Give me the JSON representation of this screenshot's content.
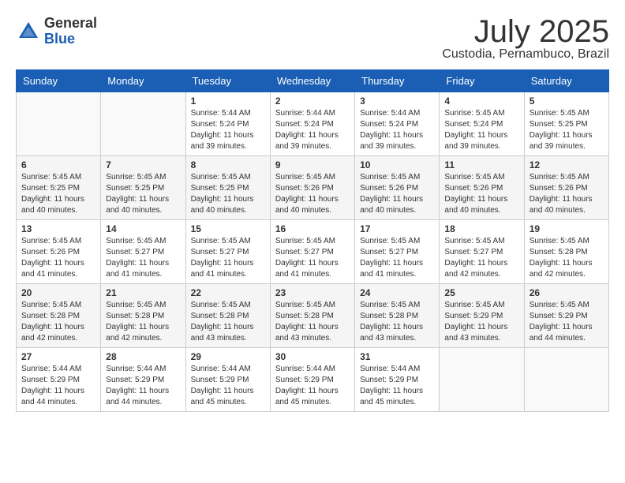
{
  "logo": {
    "general": "General",
    "blue": "Blue"
  },
  "title": "July 2025",
  "location": "Custodia, Pernambuco, Brazil",
  "days_of_week": [
    "Sunday",
    "Monday",
    "Tuesday",
    "Wednesday",
    "Thursday",
    "Friday",
    "Saturday"
  ],
  "weeks": [
    [
      {
        "day": "",
        "info": ""
      },
      {
        "day": "",
        "info": ""
      },
      {
        "day": "1",
        "info": "Sunrise: 5:44 AM\nSunset: 5:24 PM\nDaylight: 11 hours and 39 minutes."
      },
      {
        "day": "2",
        "info": "Sunrise: 5:44 AM\nSunset: 5:24 PM\nDaylight: 11 hours and 39 minutes."
      },
      {
        "day": "3",
        "info": "Sunrise: 5:44 AM\nSunset: 5:24 PM\nDaylight: 11 hours and 39 minutes."
      },
      {
        "day": "4",
        "info": "Sunrise: 5:45 AM\nSunset: 5:24 PM\nDaylight: 11 hours and 39 minutes."
      },
      {
        "day": "5",
        "info": "Sunrise: 5:45 AM\nSunset: 5:25 PM\nDaylight: 11 hours and 39 minutes."
      }
    ],
    [
      {
        "day": "6",
        "info": "Sunrise: 5:45 AM\nSunset: 5:25 PM\nDaylight: 11 hours and 40 minutes."
      },
      {
        "day": "7",
        "info": "Sunrise: 5:45 AM\nSunset: 5:25 PM\nDaylight: 11 hours and 40 minutes."
      },
      {
        "day": "8",
        "info": "Sunrise: 5:45 AM\nSunset: 5:25 PM\nDaylight: 11 hours and 40 minutes."
      },
      {
        "day": "9",
        "info": "Sunrise: 5:45 AM\nSunset: 5:26 PM\nDaylight: 11 hours and 40 minutes."
      },
      {
        "day": "10",
        "info": "Sunrise: 5:45 AM\nSunset: 5:26 PM\nDaylight: 11 hours and 40 minutes."
      },
      {
        "day": "11",
        "info": "Sunrise: 5:45 AM\nSunset: 5:26 PM\nDaylight: 11 hours and 40 minutes."
      },
      {
        "day": "12",
        "info": "Sunrise: 5:45 AM\nSunset: 5:26 PM\nDaylight: 11 hours and 40 minutes."
      }
    ],
    [
      {
        "day": "13",
        "info": "Sunrise: 5:45 AM\nSunset: 5:26 PM\nDaylight: 11 hours and 41 minutes."
      },
      {
        "day": "14",
        "info": "Sunrise: 5:45 AM\nSunset: 5:27 PM\nDaylight: 11 hours and 41 minutes."
      },
      {
        "day": "15",
        "info": "Sunrise: 5:45 AM\nSunset: 5:27 PM\nDaylight: 11 hours and 41 minutes."
      },
      {
        "day": "16",
        "info": "Sunrise: 5:45 AM\nSunset: 5:27 PM\nDaylight: 11 hours and 41 minutes."
      },
      {
        "day": "17",
        "info": "Sunrise: 5:45 AM\nSunset: 5:27 PM\nDaylight: 11 hours and 41 minutes."
      },
      {
        "day": "18",
        "info": "Sunrise: 5:45 AM\nSunset: 5:27 PM\nDaylight: 11 hours and 42 minutes."
      },
      {
        "day": "19",
        "info": "Sunrise: 5:45 AM\nSunset: 5:28 PM\nDaylight: 11 hours and 42 minutes."
      }
    ],
    [
      {
        "day": "20",
        "info": "Sunrise: 5:45 AM\nSunset: 5:28 PM\nDaylight: 11 hours and 42 minutes."
      },
      {
        "day": "21",
        "info": "Sunrise: 5:45 AM\nSunset: 5:28 PM\nDaylight: 11 hours and 42 minutes."
      },
      {
        "day": "22",
        "info": "Sunrise: 5:45 AM\nSunset: 5:28 PM\nDaylight: 11 hours and 43 minutes."
      },
      {
        "day": "23",
        "info": "Sunrise: 5:45 AM\nSunset: 5:28 PM\nDaylight: 11 hours and 43 minutes."
      },
      {
        "day": "24",
        "info": "Sunrise: 5:45 AM\nSunset: 5:28 PM\nDaylight: 11 hours and 43 minutes."
      },
      {
        "day": "25",
        "info": "Sunrise: 5:45 AM\nSunset: 5:29 PM\nDaylight: 11 hours and 43 minutes."
      },
      {
        "day": "26",
        "info": "Sunrise: 5:45 AM\nSunset: 5:29 PM\nDaylight: 11 hours and 44 minutes."
      }
    ],
    [
      {
        "day": "27",
        "info": "Sunrise: 5:44 AM\nSunset: 5:29 PM\nDaylight: 11 hours and 44 minutes."
      },
      {
        "day": "28",
        "info": "Sunrise: 5:44 AM\nSunset: 5:29 PM\nDaylight: 11 hours and 44 minutes."
      },
      {
        "day": "29",
        "info": "Sunrise: 5:44 AM\nSunset: 5:29 PM\nDaylight: 11 hours and 45 minutes."
      },
      {
        "day": "30",
        "info": "Sunrise: 5:44 AM\nSunset: 5:29 PM\nDaylight: 11 hours and 45 minutes."
      },
      {
        "day": "31",
        "info": "Sunrise: 5:44 AM\nSunset: 5:29 PM\nDaylight: 11 hours and 45 minutes."
      },
      {
        "day": "",
        "info": ""
      },
      {
        "day": "",
        "info": ""
      }
    ]
  ]
}
